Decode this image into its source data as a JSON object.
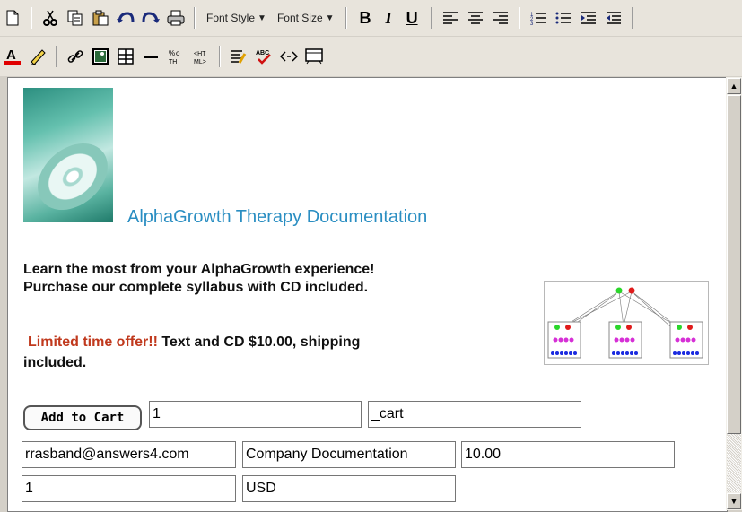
{
  "toolbar": {
    "font_style_label": "Font Style",
    "font_size_label": "Font Size",
    "bold_label": "B",
    "italic_label": "I",
    "underline_label": "U",
    "icons_row1": [
      "new-document-icon",
      "cut-icon",
      "copy-icon",
      "paste-icon",
      "undo-icon",
      "redo-icon",
      "print-icon",
      "align-left-icon",
      "align-center-icon",
      "align-right-icon",
      "numbered-list-icon",
      "bulleted-list-icon",
      "indent-icon",
      "outdent-icon"
    ],
    "icons_row2": [
      "font-color-icon",
      "highlight-icon",
      "link-icon",
      "image-icon",
      "table-icon",
      "horizontal-rule-icon",
      "special-characters-icon",
      "html-icon",
      "styles-icon",
      "spellcheck-icon",
      "code-view-icon",
      "preview-icon"
    ]
  },
  "content": {
    "heading": "AlphaGrowth Therapy Documentation",
    "paragraph1_line1": "Learn the most from your AlphaGrowth experience!",
    "paragraph1_line2": "Purchase our complete syllabus with CD included.",
    "offer_label": "Limited time offer!!",
    "offer_text": " Text and CD $10.00, shipping",
    "offer_text_line2": "included.",
    "add_to_cart_label": "Add to Cart",
    "fields": {
      "quantity": "1",
      "cmd": "_cart",
      "business": "rrasband@answers4.com",
      "item_name": "Company Documentation",
      "amount": "10.00",
      "add": "1",
      "currency": "USD"
    }
  },
  "colors": {
    "heading": "#2a8ec2",
    "offer": "#c0391d"
  }
}
